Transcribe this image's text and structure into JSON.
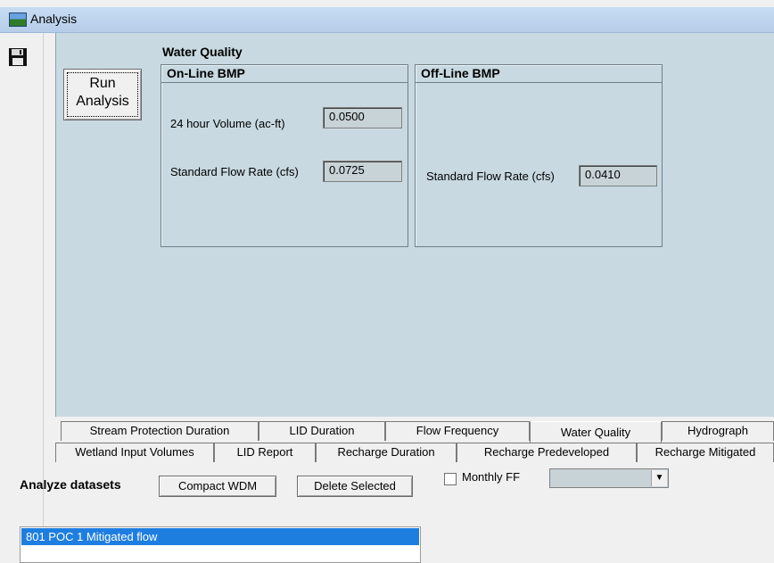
{
  "window": {
    "title": "Analysis"
  },
  "run_button": {
    "line1": "Run",
    "line2": "Analysis"
  },
  "water_quality": {
    "title": "Water Quality",
    "online": {
      "title": "On-Line BMP",
      "volume_label": "24 hour Volume (ac-ft)",
      "volume_value": "0.0500",
      "flow_label": "Standard Flow Rate  (cfs)",
      "flow_value": "0.0725"
    },
    "offline": {
      "title": "Off-Line BMP",
      "flow_label": "Standard Flow Rate  (cfs)",
      "flow_value": "0.0410"
    }
  },
  "tabs": {
    "row1": [
      "Stream Protection Duration",
      "LID Duration",
      "Flow Frequency",
      "Water Quality",
      "Hydrograph"
    ],
    "row2": [
      "Wetland Input Volumes",
      "LID Report",
      "Recharge Duration",
      "Recharge Predeveloped",
      "Recharge Mitigated"
    ],
    "active": "Water Quality"
  },
  "bottom": {
    "analyze_label": "Analyze datasets",
    "compact_button": "Compact WDM",
    "delete_button": "Delete Selected",
    "monthly_ff_label": "Monthly FF"
  },
  "datasets": [
    "801 POC 1 Mitigated flow"
  ],
  "icons": {
    "save": "floppy-disk-icon",
    "dropdown": "chevron-down-icon",
    "app": "app-window-icon"
  }
}
